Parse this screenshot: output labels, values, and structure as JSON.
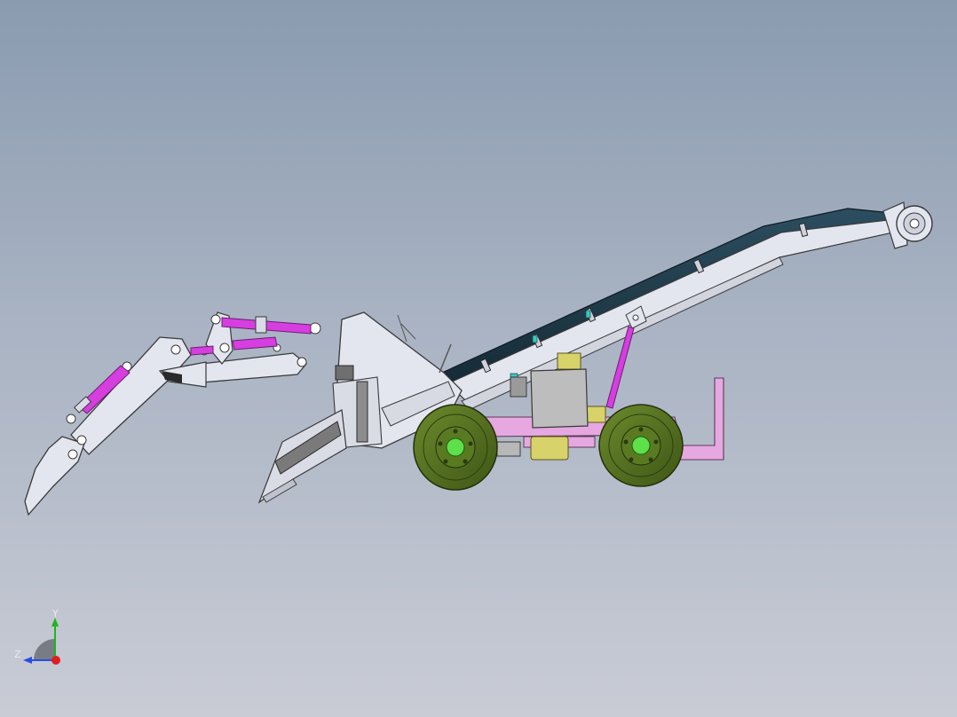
{
  "triad": {
    "y_label": "Y",
    "z_label": "Z"
  },
  "colors": {
    "background_top": "#8a9bb0",
    "background_bottom": "#c9ccd5",
    "frame": "#e4e6ef",
    "outline": "#3a3a3a",
    "hydraulic": "#d63ee0",
    "belt": "#1f3a48",
    "tire": "#4f6a1e",
    "hub": "#5de04a",
    "chassis": "#e6a8e0",
    "gearbox": "#d7d36a",
    "motor": "#bdbdbd",
    "axis_y": "#1fb51f",
    "axis_z": "#2a4de0",
    "axis_x": "#e01f1f"
  },
  "icons": [
    "coordinate-triad-icon"
  ]
}
